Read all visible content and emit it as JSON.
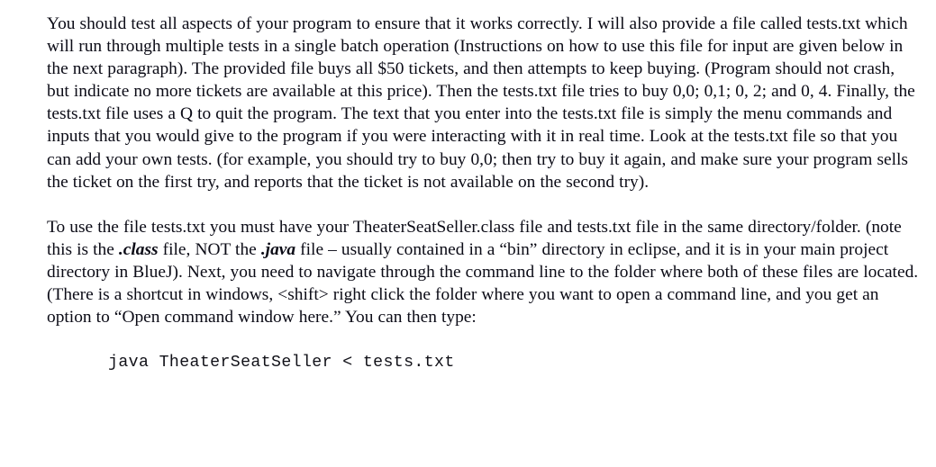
{
  "document": {
    "background_color": "#ffffff",
    "text_color": "#0b0b16",
    "paragraphs": [
      {
        "id": "testing-instructions",
        "segments": [
          {
            "style": "normal",
            "text": "You should test all aspects of your program to ensure that it works correctly.  I will also provide a file called tests.txt which will run through multiple tests in a single batch operation (Instructions on how to use this file for input are given below in the next paragraph).  The provided file buys all $50 tickets, and then attempts to keep buying.  (Program should not crash, but indicate no more tickets are available at this price).  Then the tests.txt file tries to buy 0,0; 0,1; 0, 2; and 0, 4.  Finally, the tests.txt file uses a Q to quit the program.  The text that you enter into the tests.txt file is simply the menu commands and inputs that you would give to the program if you were interacting with it in real time.  Look at the tests.txt file so that you can add your own tests.  (for example, you should try to buy 0,0; then try to buy it again, and make sure your program sells the ticket on the first try, and reports that the ticket is not available on the second try)."
          }
        ]
      },
      {
        "id": "file-usage-instructions",
        "segments": [
          {
            "style": "normal",
            "text": "To use the file tests.txt you must have your TheaterSeatSeller.class file and tests.txt file in the same directory/folder.  (note this is the "
          },
          {
            "style": "bold-italic",
            "text": ".class"
          },
          {
            "style": "normal",
            "text": " file, NOT the "
          },
          {
            "style": "bold-italic",
            "text": ".java"
          },
          {
            "style": "normal",
            "text": " file – usually contained in a “bin” directory in eclipse, and it is in your main project directory in BlueJ).  Next, you need to navigate through the command line to the folder where both of these files are located.  (There is a shortcut in windows, <shift> right click the folder where you want to open a command line, and you get an option to “Open command window here.”  You can then type:"
          }
        ]
      }
    ],
    "code_block": {
      "id": "run-command",
      "text": "java TheaterSeatSeller < tests.txt"
    }
  }
}
